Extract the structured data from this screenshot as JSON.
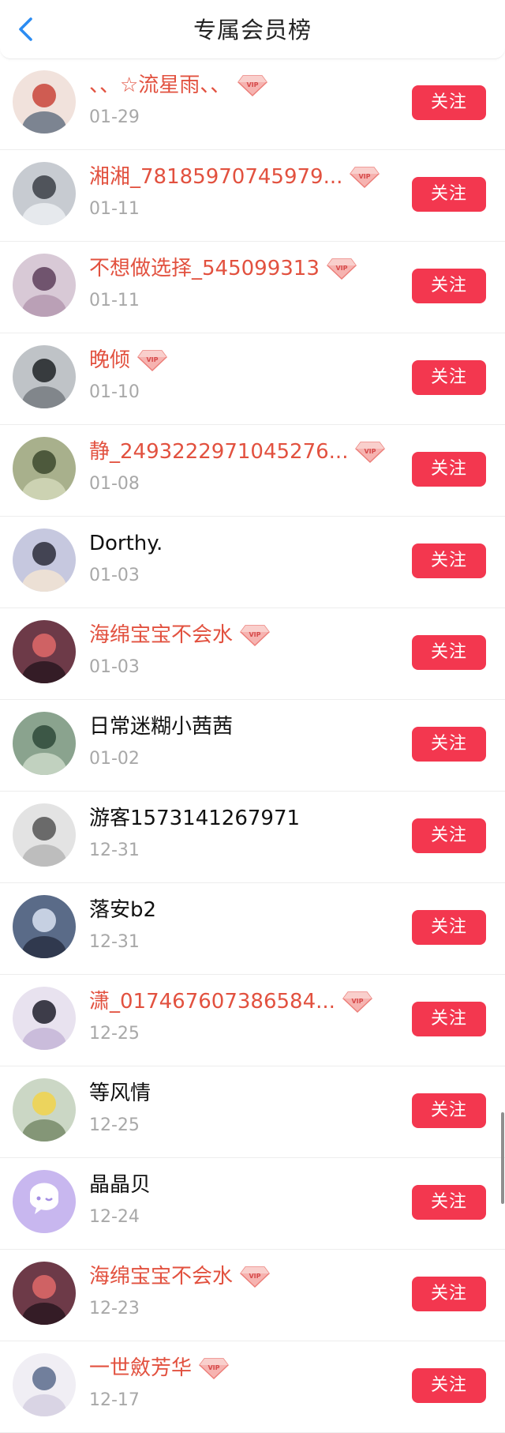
{
  "header": {
    "title": "专属会员榜",
    "back_icon": "chevron-left-icon"
  },
  "colors": {
    "vip_name": "#e2513f",
    "normal_name": "#111111",
    "follow_button": "#f3374f",
    "back_icon": "#2b8cf2"
  },
  "follow_label": "关注",
  "members": [
    {
      "name": "、、☆流星雨、、",
      "date": "01-29",
      "vip": true
    },
    {
      "name": "湘湘_78185970745979...",
      "date": "01-11",
      "vip": true
    },
    {
      "name": "不想做选择_545099313",
      "date": "01-11",
      "vip": true
    },
    {
      "name": "晚倾",
      "date": "01-10",
      "vip": true
    },
    {
      "name": "静_2493222971045276...",
      "date": "01-08",
      "vip": true
    },
    {
      "name": "Dorthy.",
      "date": "01-03",
      "vip": false
    },
    {
      "name": "海绵宝宝不会水",
      "date": "01-03",
      "vip": true
    },
    {
      "name": "日常迷糊小茜茜",
      "date": "01-02",
      "vip": false
    },
    {
      "name": "游客1573141267971",
      "date": "12-31",
      "vip": false
    },
    {
      "name": "落安b2",
      "date": "12-31",
      "vip": false
    },
    {
      "name": "潇_017467607386584...",
      "date": "12-25",
      "vip": true
    },
    {
      "name": "等风情",
      "date": "12-25",
      "vip": false
    },
    {
      "name": "晶晶贝",
      "date": "12-24",
      "vip": false
    },
    {
      "name": "海绵宝宝不会水",
      "date": "12-23",
      "vip": true
    },
    {
      "name": "一世斂芳华",
      "date": "12-17",
      "vip": true
    }
  ],
  "vip_badge_text": "VIP"
}
